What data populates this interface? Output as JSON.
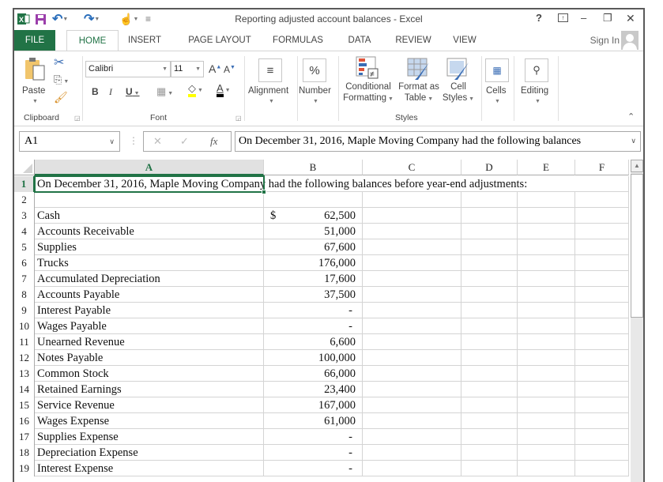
{
  "window": {
    "title": "Reporting adjusted account balances - Excel",
    "help": "?",
    "controls": {
      "ribbon_display": "⊼",
      "minimize": "–",
      "restore": "❐",
      "close": "✕"
    }
  },
  "qat": {
    "app_icon": "X",
    "save_icon": "save-icon",
    "undo_icon": "undo-icon",
    "redo_icon": "redo-icon",
    "touch_icon": "touch-mode-icon",
    "customize": "="
  },
  "tabs": [
    "FILE",
    "HOME",
    "INSERT",
    "PAGE LAYOUT",
    "FORMULAS",
    "DATA",
    "REVIEW",
    "VIEW"
  ],
  "active_tab": "HOME",
  "account": {
    "sign_in": "Sign In"
  },
  "ribbon": {
    "clipboard": {
      "paste": "Paste",
      "label": "Clipboard"
    },
    "font": {
      "name": "Calibri",
      "size": "11",
      "bold": "B",
      "italic": "I",
      "underline": "U",
      "grow": "A",
      "shrink": "A",
      "label": "Font",
      "fill_color": "#ffff00",
      "font_color": "#000000"
    },
    "alignment": {
      "label": "Alignment"
    },
    "number": {
      "label": "Number",
      "icon": "%"
    },
    "styles": {
      "conditional_1": "Conditional",
      "conditional_2": "Formatting",
      "format_table_1": "Format as",
      "format_table_2": "Table",
      "cell_styles_1": "Cell",
      "cell_styles_2": "Styles",
      "label": "Styles"
    },
    "cells": {
      "label": "Cells"
    },
    "editing": {
      "label": "Editing"
    }
  },
  "formula_bar": {
    "name_box": "A1",
    "cancel": "✕",
    "enter": "✓",
    "fx": "fx",
    "content": "On December 31, 2016, Maple Moving Company had the following balances"
  },
  "sheet": {
    "columns": [
      "A",
      "B",
      "C",
      "D",
      "E",
      "F"
    ],
    "selected_cell": "A1",
    "accent": "#217346",
    "rows": [
      {
        "n": "1",
        "a": "On December 31, 2016, Maple Moving Company had the following balances before year-end adjustments:",
        "cur": "",
        "b": ""
      },
      {
        "n": "2",
        "a": "",
        "cur": "",
        "b": ""
      },
      {
        "n": "3",
        "a": "Cash",
        "cur": "$",
        "b": "62,500"
      },
      {
        "n": "4",
        "a": "Accounts Receivable",
        "cur": "",
        "b": "51,000"
      },
      {
        "n": "5",
        "a": "Supplies",
        "cur": "",
        "b": "67,600"
      },
      {
        "n": "6",
        "a": "Trucks",
        "cur": "",
        "b": "176,000"
      },
      {
        "n": "7",
        "a": "Accumulated Depreciation",
        "cur": "",
        "b": "17,600"
      },
      {
        "n": "8",
        "a": "Accounts Payable",
        "cur": "",
        "b": "37,500"
      },
      {
        "n": "9",
        "a": "Interest Payable",
        "cur": "",
        "b": "-"
      },
      {
        "n": "10",
        "a": "Wages Payable",
        "cur": "",
        "b": "-"
      },
      {
        "n": "11",
        "a": "Unearned Revenue",
        "cur": "",
        "b": "6,600"
      },
      {
        "n": "12",
        "a": "Notes Payable",
        "cur": "",
        "b": "100,000"
      },
      {
        "n": "13",
        "a": "Common Stock",
        "cur": "",
        "b": "66,000"
      },
      {
        "n": "14",
        "a": "Retained Earnings",
        "cur": "",
        "b": "23,400"
      },
      {
        "n": "15",
        "a": "Service Revenue",
        "cur": "",
        "b": "167,000"
      },
      {
        "n": "16",
        "a": "Wages Expense",
        "cur": "",
        "b": "61,000"
      },
      {
        "n": "17",
        "a": "Supplies Expense",
        "cur": "",
        "b": "-"
      },
      {
        "n": "18",
        "a": "Depreciation Expense",
        "cur": "",
        "b": "-"
      },
      {
        "n": "19",
        "a": "Interest Expense",
        "cur": "",
        "b": "-"
      }
    ]
  }
}
